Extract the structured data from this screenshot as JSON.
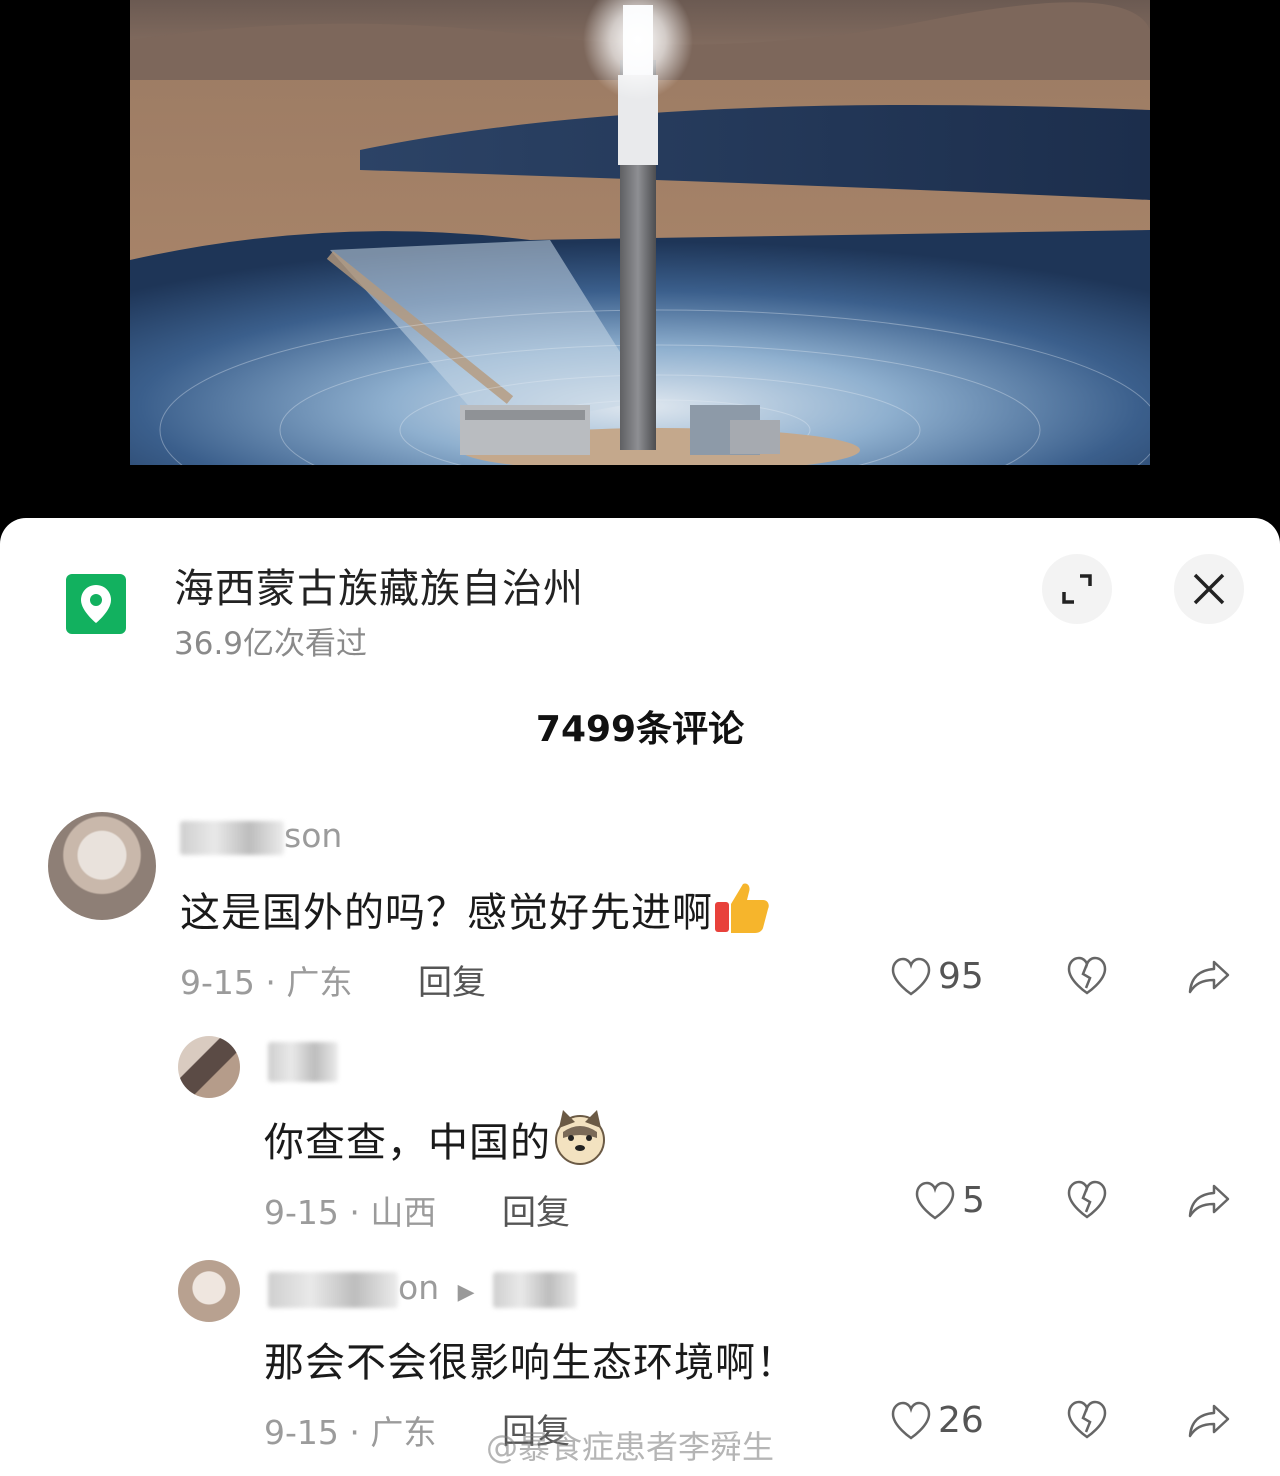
{
  "location": {
    "title": "海西蒙古族藏族自治州",
    "views": "36.9亿次看过",
    "icon": "location-pin-icon",
    "icon_color": "#12b15f"
  },
  "header": {
    "comment_count": "7499条评论"
  },
  "comments": [
    {
      "username_visible": "son",
      "text": "这是国外的吗？感觉好先进啊",
      "date_region": "9-15 · 广东",
      "reply_label": "回复",
      "likes": "95"
    },
    {
      "username_visible": "",
      "text": "你查查，中国的",
      "date_region": "9-15 · 山西",
      "reply_label": "回复",
      "likes": "5"
    },
    {
      "username_visible": "on",
      "text": "那会不会很影响生态环境啊！",
      "date_region": "9-15 · 广东",
      "reply_label": "回复",
      "likes": "26"
    }
  ],
  "watermark": "@暴食症患者李舜生"
}
